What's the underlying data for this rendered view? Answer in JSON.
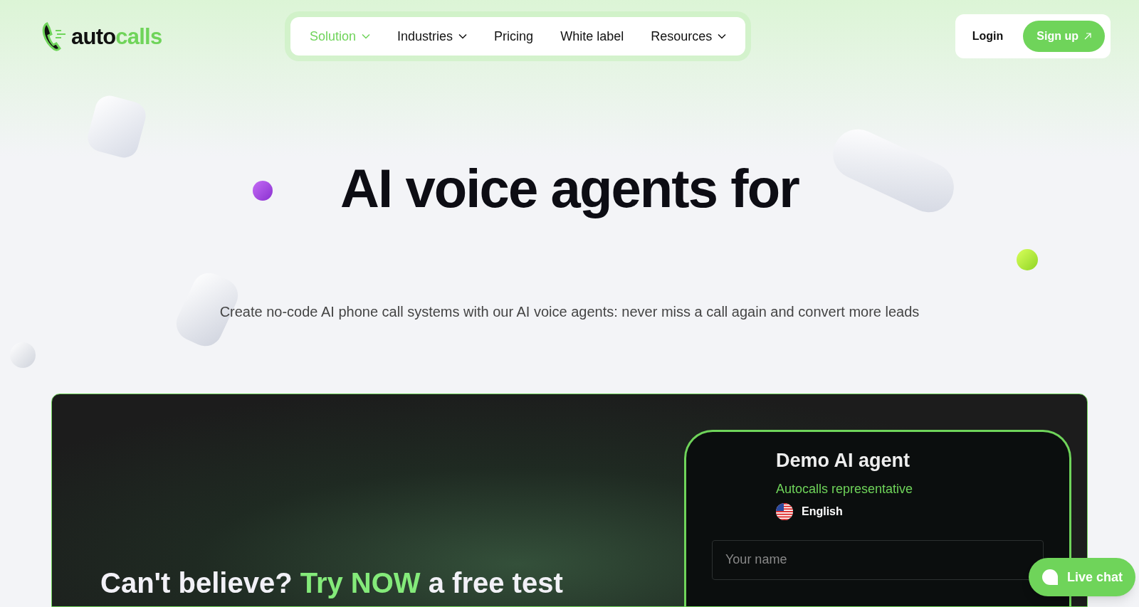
{
  "logo": {
    "part_1": "auto",
    "part_2": "calls"
  },
  "nav": [
    {
      "label": "Solution",
      "selected": true,
      "dropdown": true
    },
    {
      "label": "Industries",
      "selected": false,
      "dropdown": true
    },
    {
      "label": "Pricing",
      "selected": false,
      "dropdown": false
    },
    {
      "label": "White label",
      "selected": false,
      "dropdown": false
    },
    {
      "label": "Resources",
      "selected": false,
      "dropdown": true
    }
  ],
  "auth": {
    "login": "Login",
    "signup": "Sign up"
  },
  "hero": {
    "title": "AI voice agents for",
    "subtitle": "Create no-code AI phone call systems with our AI voice agents: never miss a call again and convert more leads"
  },
  "demo_section": {
    "headline_before": "Can't believe?",
    "headline_highlight": "Try NOW",
    "headline_after": "a free test",
    "agent": {
      "title": "Demo AI agent",
      "role": "Autocalls representative",
      "language": "English",
      "name_field": {
        "placeholder": "Your name"
      }
    }
  },
  "live_chat": "Live chat"
}
